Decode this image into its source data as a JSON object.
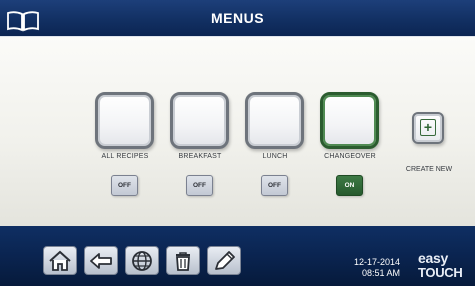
{
  "header": {
    "title": "MENUS",
    "left_icon": "book-icon"
  },
  "menus": [
    {
      "label": "ALL RECIPES",
      "toggle": "OFF",
      "active": false
    },
    {
      "label": "BREAKFAST",
      "toggle": "OFF",
      "active": false
    },
    {
      "label": "LUNCH",
      "toggle": "OFF",
      "active": false
    },
    {
      "label": "CHANGEOVER",
      "toggle": "ON",
      "active": true
    }
  ],
  "create": {
    "icon": "plus-icon",
    "symbol": "+",
    "label": "CREATE NEW"
  },
  "footer": {
    "buttons": [
      {
        "icon": "home-icon"
      },
      {
        "icon": "back-arrow-icon"
      },
      {
        "icon": "globe-icon"
      },
      {
        "icon": "trash-icon"
      },
      {
        "icon": "pencil-icon"
      }
    ],
    "date": "12-17-2014",
    "time": "08:51 AM",
    "brand_line1": "easy",
    "brand_line2": "TOUCH"
  },
  "colors": {
    "header_bg": "#123063",
    "footer_bg": "#0a2450",
    "active_green": "#2b5c2f",
    "panel_bg": "#f1f1ec"
  }
}
